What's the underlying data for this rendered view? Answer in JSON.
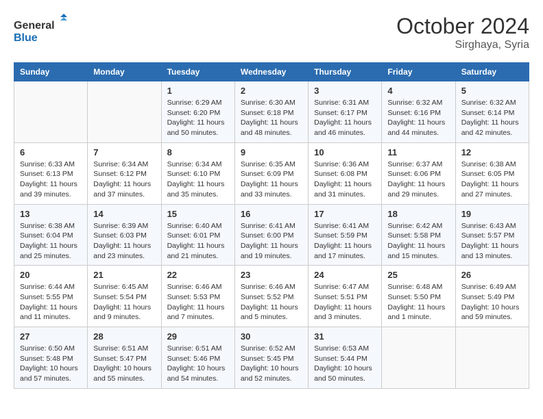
{
  "logo": {
    "line1": "General",
    "line2": "Blue"
  },
  "title": "October 2024",
  "location": "Sirghaya, Syria",
  "days_header": [
    "Sunday",
    "Monday",
    "Tuesday",
    "Wednesday",
    "Thursday",
    "Friday",
    "Saturday"
  ],
  "weeks": [
    [
      {
        "day": "",
        "content": ""
      },
      {
        "day": "",
        "content": ""
      },
      {
        "day": "1",
        "content": "Sunrise: 6:29 AM\nSunset: 6:20 PM\nDaylight: 11 hours and 50 minutes."
      },
      {
        "day": "2",
        "content": "Sunrise: 6:30 AM\nSunset: 6:18 PM\nDaylight: 11 hours and 48 minutes."
      },
      {
        "day": "3",
        "content": "Sunrise: 6:31 AM\nSunset: 6:17 PM\nDaylight: 11 hours and 46 minutes."
      },
      {
        "day": "4",
        "content": "Sunrise: 6:32 AM\nSunset: 6:16 PM\nDaylight: 11 hours and 44 minutes."
      },
      {
        "day": "5",
        "content": "Sunrise: 6:32 AM\nSunset: 6:14 PM\nDaylight: 11 hours and 42 minutes."
      }
    ],
    [
      {
        "day": "6",
        "content": "Sunrise: 6:33 AM\nSunset: 6:13 PM\nDaylight: 11 hours and 39 minutes."
      },
      {
        "day": "7",
        "content": "Sunrise: 6:34 AM\nSunset: 6:12 PM\nDaylight: 11 hours and 37 minutes."
      },
      {
        "day": "8",
        "content": "Sunrise: 6:34 AM\nSunset: 6:10 PM\nDaylight: 11 hours and 35 minutes."
      },
      {
        "day": "9",
        "content": "Sunrise: 6:35 AM\nSunset: 6:09 PM\nDaylight: 11 hours and 33 minutes."
      },
      {
        "day": "10",
        "content": "Sunrise: 6:36 AM\nSunset: 6:08 PM\nDaylight: 11 hours and 31 minutes."
      },
      {
        "day": "11",
        "content": "Sunrise: 6:37 AM\nSunset: 6:06 PM\nDaylight: 11 hours and 29 minutes."
      },
      {
        "day": "12",
        "content": "Sunrise: 6:38 AM\nSunset: 6:05 PM\nDaylight: 11 hours and 27 minutes."
      }
    ],
    [
      {
        "day": "13",
        "content": "Sunrise: 6:38 AM\nSunset: 6:04 PM\nDaylight: 11 hours and 25 minutes."
      },
      {
        "day": "14",
        "content": "Sunrise: 6:39 AM\nSunset: 6:03 PM\nDaylight: 11 hours and 23 minutes."
      },
      {
        "day": "15",
        "content": "Sunrise: 6:40 AM\nSunset: 6:01 PM\nDaylight: 11 hours and 21 minutes."
      },
      {
        "day": "16",
        "content": "Sunrise: 6:41 AM\nSunset: 6:00 PM\nDaylight: 11 hours and 19 minutes."
      },
      {
        "day": "17",
        "content": "Sunrise: 6:41 AM\nSunset: 5:59 PM\nDaylight: 11 hours and 17 minutes."
      },
      {
        "day": "18",
        "content": "Sunrise: 6:42 AM\nSunset: 5:58 PM\nDaylight: 11 hours and 15 minutes."
      },
      {
        "day": "19",
        "content": "Sunrise: 6:43 AM\nSunset: 5:57 PM\nDaylight: 11 hours and 13 minutes."
      }
    ],
    [
      {
        "day": "20",
        "content": "Sunrise: 6:44 AM\nSunset: 5:55 PM\nDaylight: 11 hours and 11 minutes."
      },
      {
        "day": "21",
        "content": "Sunrise: 6:45 AM\nSunset: 5:54 PM\nDaylight: 11 hours and 9 minutes."
      },
      {
        "day": "22",
        "content": "Sunrise: 6:46 AM\nSunset: 5:53 PM\nDaylight: 11 hours and 7 minutes."
      },
      {
        "day": "23",
        "content": "Sunrise: 6:46 AM\nSunset: 5:52 PM\nDaylight: 11 hours and 5 minutes."
      },
      {
        "day": "24",
        "content": "Sunrise: 6:47 AM\nSunset: 5:51 PM\nDaylight: 11 hours and 3 minutes."
      },
      {
        "day": "25",
        "content": "Sunrise: 6:48 AM\nSunset: 5:50 PM\nDaylight: 11 hours and 1 minute."
      },
      {
        "day": "26",
        "content": "Sunrise: 6:49 AM\nSunset: 5:49 PM\nDaylight: 10 hours and 59 minutes."
      }
    ],
    [
      {
        "day": "27",
        "content": "Sunrise: 6:50 AM\nSunset: 5:48 PM\nDaylight: 10 hours and 57 minutes."
      },
      {
        "day": "28",
        "content": "Sunrise: 6:51 AM\nSunset: 5:47 PM\nDaylight: 10 hours and 55 minutes."
      },
      {
        "day": "29",
        "content": "Sunrise: 6:51 AM\nSunset: 5:46 PM\nDaylight: 10 hours and 54 minutes."
      },
      {
        "day": "30",
        "content": "Sunrise: 6:52 AM\nSunset: 5:45 PM\nDaylight: 10 hours and 52 minutes."
      },
      {
        "day": "31",
        "content": "Sunrise: 6:53 AM\nSunset: 5:44 PM\nDaylight: 10 hours and 50 minutes."
      },
      {
        "day": "",
        "content": ""
      },
      {
        "day": "",
        "content": ""
      }
    ]
  ]
}
